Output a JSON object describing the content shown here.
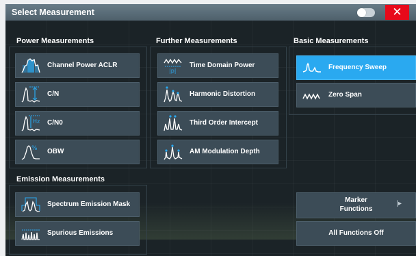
{
  "window": {
    "title": "Select Measurement",
    "close_symbol": "✕"
  },
  "groups": {
    "power": {
      "label": "Power Measurements",
      "items": [
        {
          "label": "Channel Power ACLR",
          "icon": "channel-power-aclr-icon"
        },
        {
          "label": "C/N",
          "icon": "carrier-noise-icon"
        },
        {
          "label": "C/N0",
          "icon": "carrier-noise-hz-icon",
          "icon_text": "Hz"
        },
        {
          "label": "OBW",
          "icon": "obw-icon",
          "icon_text": "%"
        }
      ]
    },
    "further": {
      "label": "Further Measurements",
      "items": [
        {
          "label": "Time Domain Power",
          "icon": "time-domain-power-icon",
          "icon_text": "|p|"
        },
        {
          "label": "Harmonic Distortion",
          "icon": "harmonic-distortion-icon"
        },
        {
          "label": "Third Order Intercept",
          "icon": "third-order-intercept-icon"
        },
        {
          "label": "AM Modulation Depth",
          "icon": "am-modulation-depth-icon"
        }
      ]
    },
    "basic": {
      "label": "Basic Measurements",
      "items": [
        {
          "label": "Frequency Sweep",
          "icon": "frequency-sweep-icon",
          "selected": true
        },
        {
          "label": "Zero Span",
          "icon": "zero-span-icon",
          "selected": false
        }
      ]
    },
    "emission": {
      "label": "Emission Measurements",
      "items": [
        {
          "label": "Spectrum Emission Mask",
          "icon": "spectrum-emission-mask-icon"
        },
        {
          "label": "Spurious Emissions",
          "icon": "spurious-emissions-icon"
        }
      ]
    }
  },
  "side_buttons": {
    "marker_functions": {
      "line1": "Marker",
      "line2": "Functions",
      "arrow": "|▸"
    },
    "all_functions_off": "All Functions Off"
  },
  "colors": {
    "accent": "#2aa9f0",
    "button": "#3c4c57",
    "background": "#1b2327",
    "close": "#e8091a"
  }
}
